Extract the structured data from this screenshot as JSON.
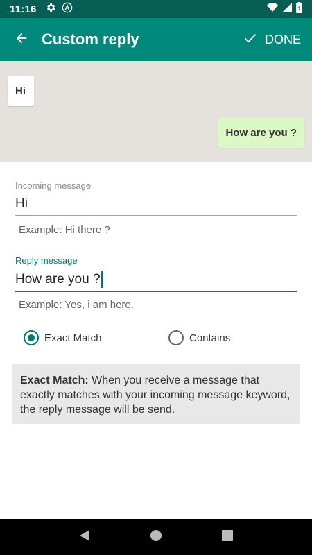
{
  "status_bar": {
    "time": "11:16",
    "icons_left": [
      "gear-icon",
      "a-circle-icon"
    ],
    "icons_right": [
      "wifi-icon",
      "signal-icon",
      "battery-icon"
    ]
  },
  "app_bar": {
    "title": "Custom reply",
    "done_label": "DONE",
    "color": "#00897b"
  },
  "chat_preview": {
    "incoming_bubble": "Hi",
    "outgoing_bubble": "How are you ?"
  },
  "form": {
    "incoming": {
      "label": "Incoming message",
      "value": "Hi",
      "helper": "Example: Hi there ?"
    },
    "reply": {
      "label": "Reply message",
      "value": "How are you ?",
      "helper": "Example: Yes, i am here."
    }
  },
  "match_options": {
    "exact_label": "Exact Match",
    "contains_label": "Contains",
    "selected": "Exact Match"
  },
  "info": {
    "title": "Exact Match:",
    "text": " When you receive a message that exactly matches with your incoming message keyword, the reply message will be send."
  },
  "nav_bar": {
    "icons": [
      "back-triangle-icon",
      "home-circle-icon",
      "recents-square-icon"
    ]
  },
  "colors": {
    "accent": "#00796b",
    "status_bar": "#075e54",
    "chat_bg": "#e5e2dd",
    "outgoing_bubble": "#dcf8c6"
  }
}
